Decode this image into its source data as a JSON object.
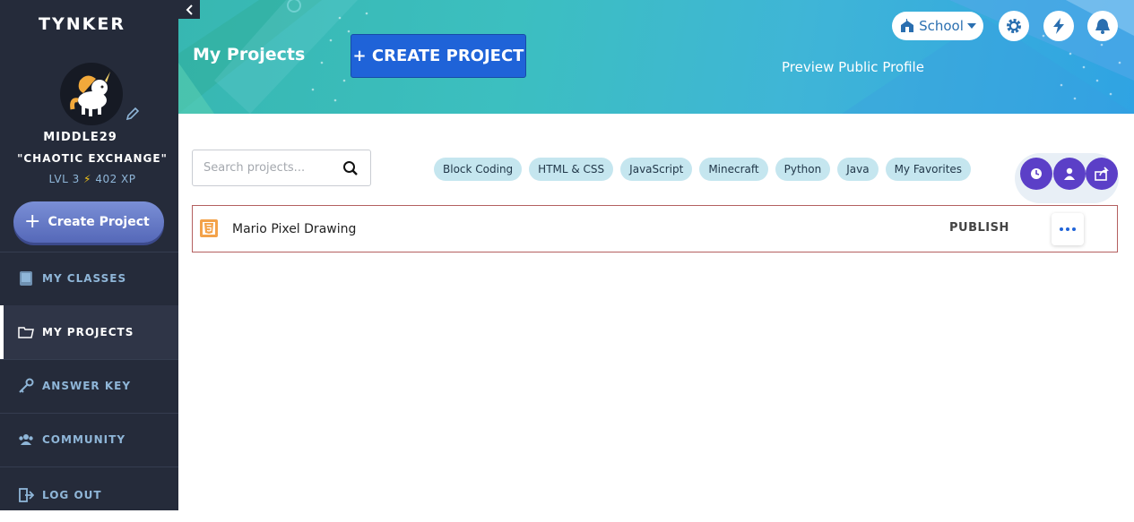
{
  "app": {
    "logo_text": "TYNKER"
  },
  "profile": {
    "username": "MIDDLE29",
    "title": "\"CHAOTIC EXCHANGE\"",
    "level": "LVL 3",
    "xp": "402 XP"
  },
  "sidebar": {
    "create_label": "Create Project",
    "items": [
      {
        "label": "MY CLASSES",
        "icon": "book-icon"
      },
      {
        "label": "MY PROJECTS",
        "icon": "folder-icon",
        "active": true
      },
      {
        "label": "ANSWER KEY",
        "icon": "key-icon"
      },
      {
        "label": "COMMUNITY",
        "icon": "community-icon"
      },
      {
        "label": "LOG OUT",
        "icon": "logout-icon"
      }
    ]
  },
  "header": {
    "page_title": "My Projects",
    "create_button": "+ CREATE PROJECT",
    "preview_link": "Preview Public Profile",
    "school_label": "School"
  },
  "search": {
    "placeholder": "Search projects..."
  },
  "filters": [
    "Block Coding",
    "HTML & CSS",
    "JavaScript",
    "Minecraft",
    "Python",
    "Java",
    "My Favorites"
  ],
  "projects": [
    {
      "name": "Mario Pixel Drawing",
      "type_icon": "html5-icon",
      "action": "PUBLISH"
    }
  ],
  "colors": {
    "sidebar_bg": "#252b3a",
    "accent_blue": "#1f63d8",
    "fab_purple": "#5b3fc7",
    "chip_bg": "#c5e6ef"
  }
}
